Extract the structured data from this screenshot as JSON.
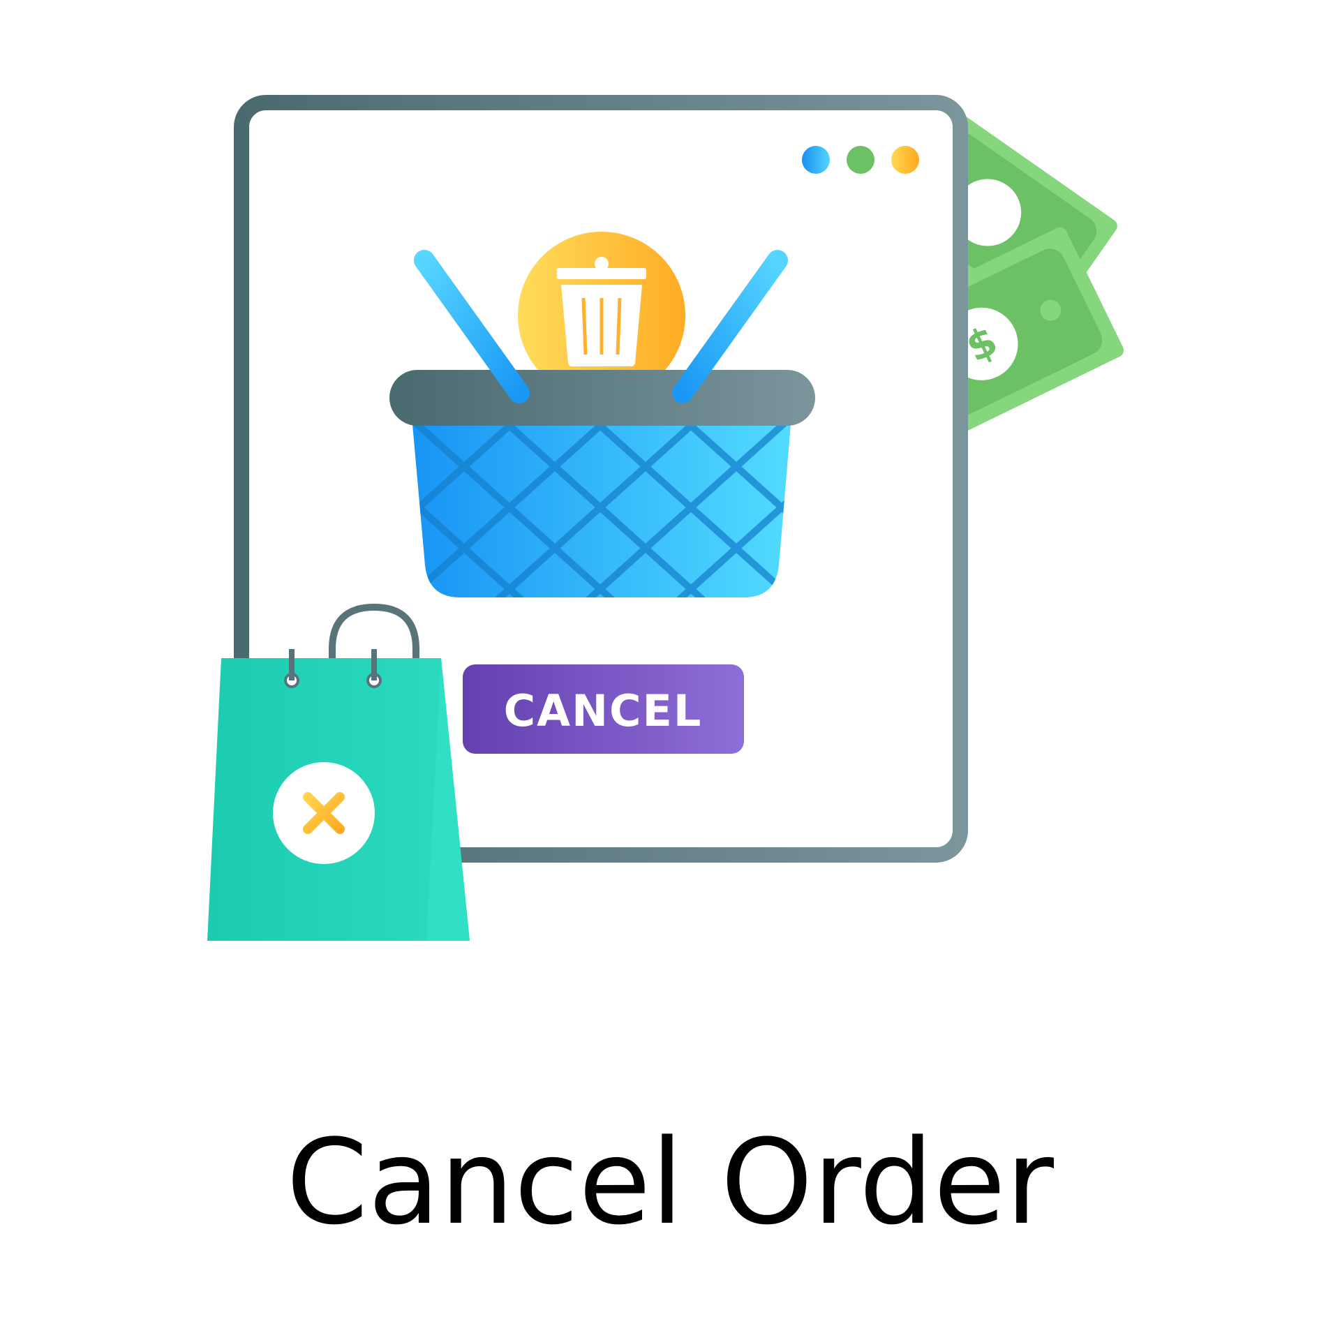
{
  "illustration": {
    "button_label": "CANCEL",
    "icons": {
      "window": "browser-window-icon",
      "basket": "shopping-basket-icon",
      "trash": "trash-icon",
      "bag": "shopping-bag-icon",
      "close": "close-icon",
      "money": "money-bills-icon",
      "dollar": "dollar-icon"
    },
    "colors": {
      "window_frame": "#4d6b72",
      "dot_blue": "#1d9bf0",
      "dot_green": "#6cc164",
      "dot_orange": "#ffb02e",
      "basket_blue": "#1d9bf0",
      "trash_badge": "#ffb02e",
      "button_purple": "#6e48b6",
      "bag_teal": "#1ccfb2",
      "money_green": "#6cc164"
    }
  },
  "caption": {
    "text": "Cancel Order"
  }
}
